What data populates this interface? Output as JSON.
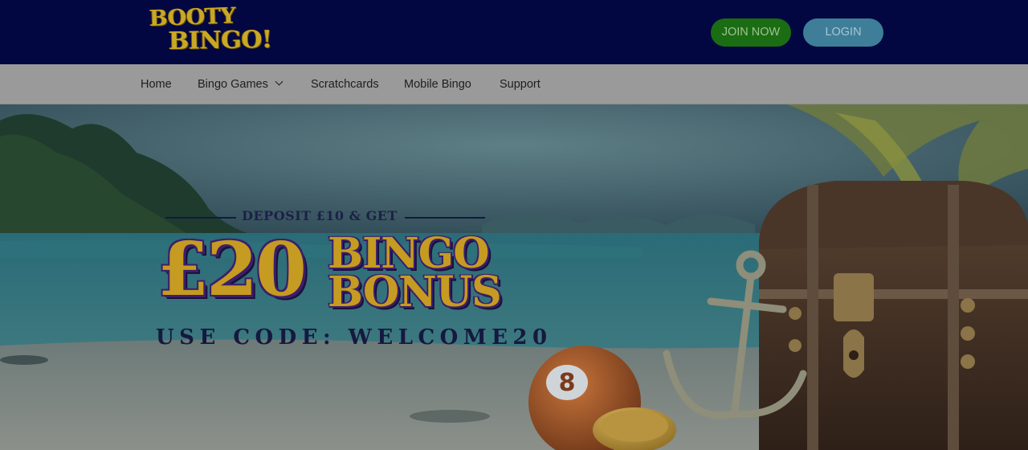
{
  "header": {
    "logo_line1": "BOOTY",
    "logo_line2": "BINGO!",
    "join_label": "JOIN NOW",
    "login_label": "LOGIN"
  },
  "nav": {
    "items": [
      {
        "label": "Home"
      },
      {
        "label": "Bingo Games",
        "has_dropdown": true
      },
      {
        "label": "Scratchcards"
      },
      {
        "label": "Mobile Bingo"
      },
      {
        "label": "Support"
      }
    ]
  },
  "hero": {
    "deposit_text": "DEPOSIT £10 & GET",
    "amount": "£20",
    "bonus_line1": "BINGO",
    "bonus_line2": "BONUS",
    "code_text": "USE CODE: WELCOME20",
    "ball_number": "8"
  },
  "colors": {
    "header_bg": "#020741",
    "nav_bg": "#9a9a9a",
    "join_bg": "#1a6d13",
    "login_bg": "#3f7e98",
    "promo_gold": "#c59b22",
    "promo_outline": "#3c1f6a"
  }
}
